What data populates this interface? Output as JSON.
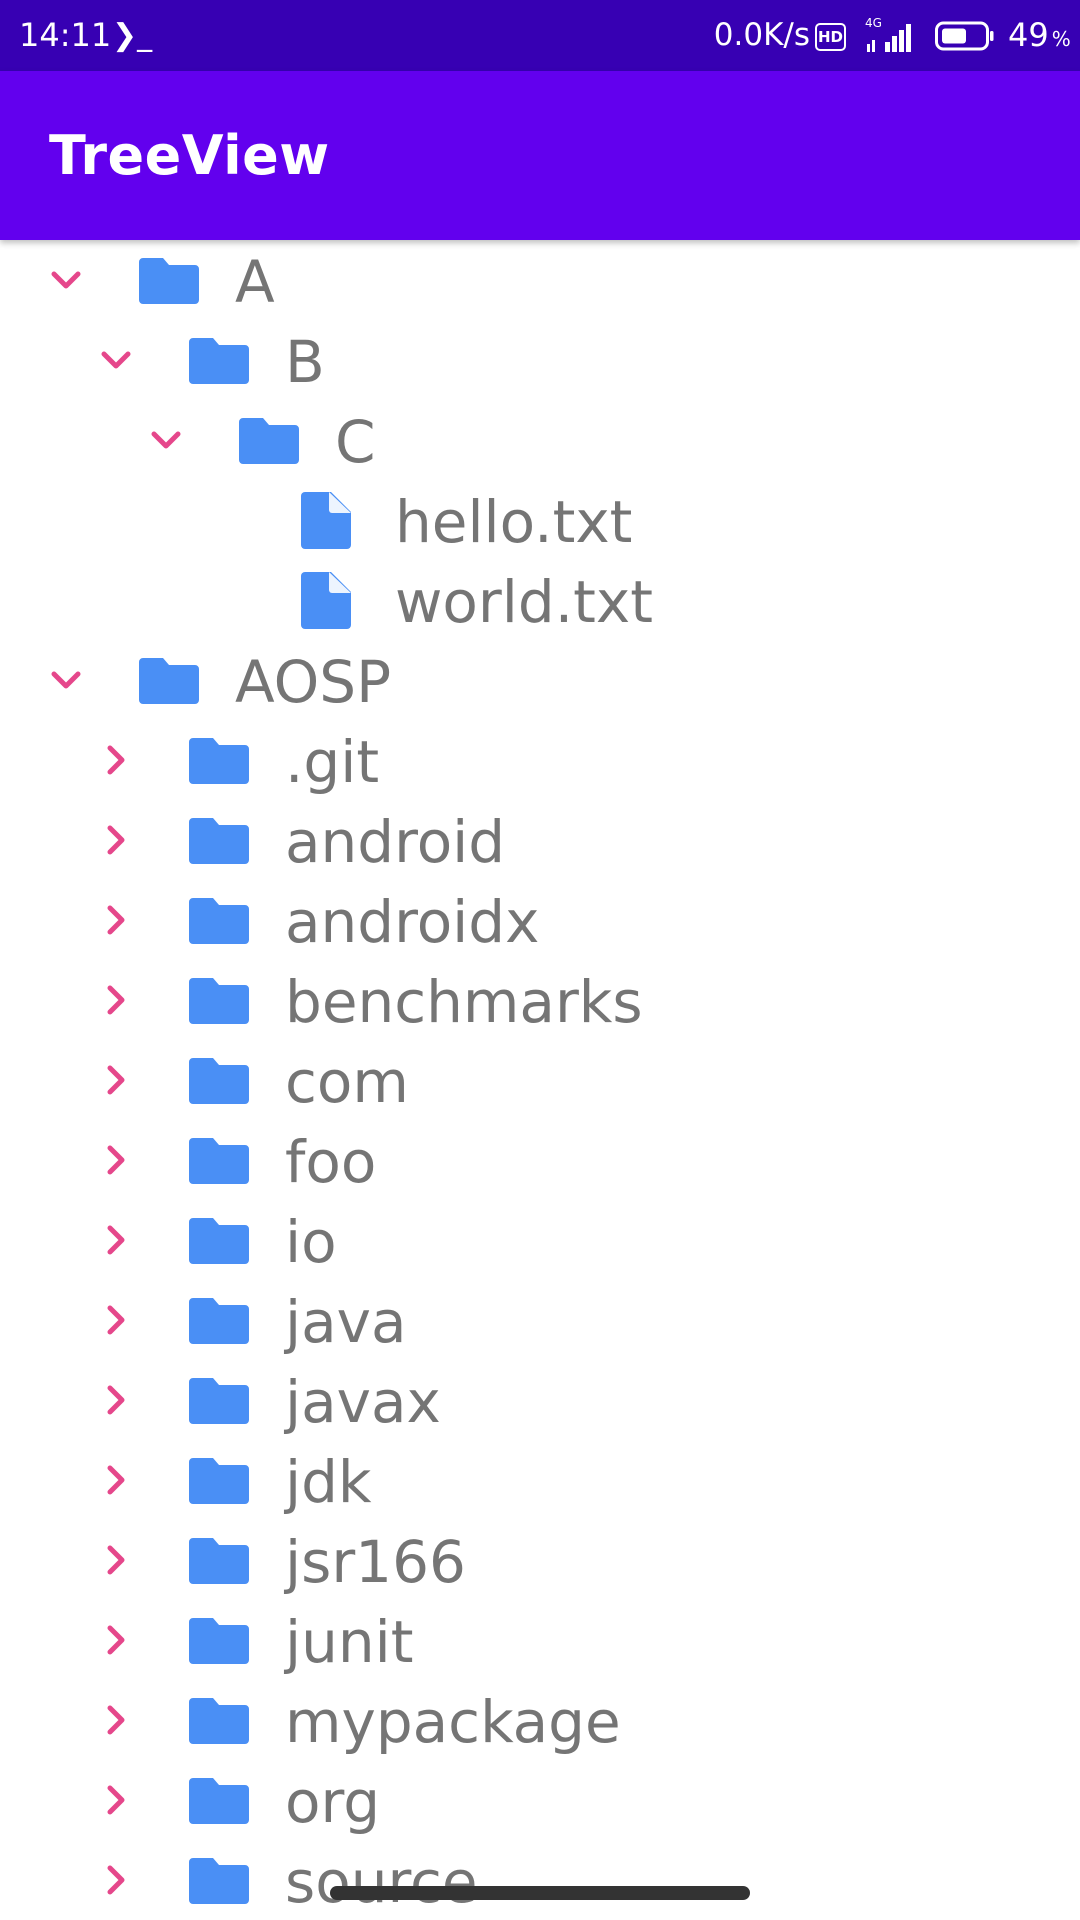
{
  "status_bar": {
    "time": "14:11",
    "terminal_glyph": "❯_",
    "net_speed": "0.0K/s",
    "hd_badge": "HD",
    "network_type": "4G",
    "battery_percent": "49",
    "battery_unit": "%"
  },
  "app_bar": {
    "title": "TreeView"
  },
  "colors": {
    "status_bar_bg": "#3700b3",
    "app_bar_bg": "#6200ee",
    "chevron": "#e5478b",
    "icon": "#4a8ff5",
    "label": "#757575"
  },
  "tree": [
    {
      "label": "A",
      "type": "folder",
      "depth": 0,
      "expanded": true
    },
    {
      "label": "B",
      "type": "folder",
      "depth": 1,
      "expanded": true
    },
    {
      "label": "C",
      "type": "folder",
      "depth": 2,
      "expanded": true
    },
    {
      "label": "hello.txt",
      "type": "file",
      "depth": 3
    },
    {
      "label": "world.txt",
      "type": "file",
      "depth": 3
    },
    {
      "label": "AOSP",
      "type": "folder",
      "depth": 0,
      "expanded": true
    },
    {
      "label": ".git",
      "type": "folder",
      "depth": 1,
      "expanded": false
    },
    {
      "label": "android",
      "type": "folder",
      "depth": 1,
      "expanded": false
    },
    {
      "label": "androidx",
      "type": "folder",
      "depth": 1,
      "expanded": false
    },
    {
      "label": "benchmarks",
      "type": "folder",
      "depth": 1,
      "expanded": false
    },
    {
      "label": "com",
      "type": "folder",
      "depth": 1,
      "expanded": false
    },
    {
      "label": "foo",
      "type": "folder",
      "depth": 1,
      "expanded": false
    },
    {
      "label": "io",
      "type": "folder",
      "depth": 1,
      "expanded": false
    },
    {
      "label": "java",
      "type": "folder",
      "depth": 1,
      "expanded": false
    },
    {
      "label": "javax",
      "type": "folder",
      "depth": 1,
      "expanded": false
    },
    {
      "label": "jdk",
      "type": "folder",
      "depth": 1,
      "expanded": false
    },
    {
      "label": "jsr166",
      "type": "folder",
      "depth": 1,
      "expanded": false
    },
    {
      "label": "junit",
      "type": "folder",
      "depth": 1,
      "expanded": false
    },
    {
      "label": "mypackage",
      "type": "folder",
      "depth": 1,
      "expanded": false
    },
    {
      "label": "org",
      "type": "folder",
      "depth": 1,
      "expanded": false
    },
    {
      "label": "source",
      "type": "folder",
      "depth": 1,
      "expanded": false
    }
  ]
}
